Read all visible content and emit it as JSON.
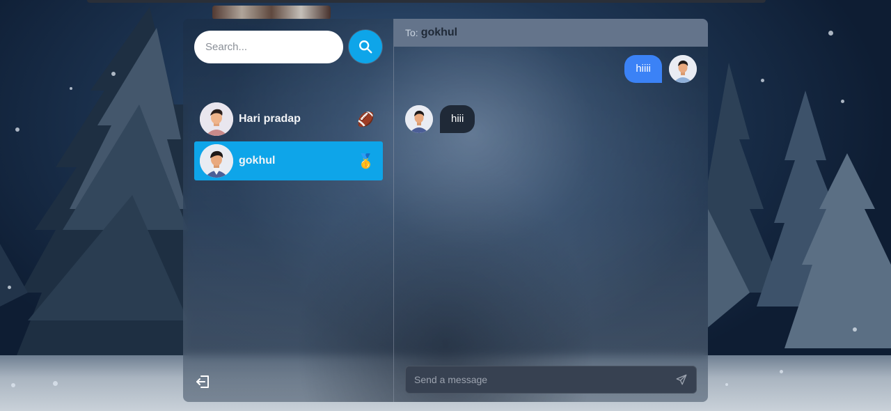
{
  "sidebar": {
    "search": {
      "placeholder": "Search...",
      "value": ""
    },
    "search_button_icon": "search-icon",
    "contacts": [
      {
        "name": "Hari pradap",
        "emoji": "🏈",
        "selected": false
      },
      {
        "name": "gokhul",
        "emoji": "🥇",
        "selected": true
      }
    ],
    "logout_icon": "logout-icon"
  },
  "chat": {
    "header": {
      "to_label": "To:",
      "recipient": "gokhul"
    },
    "messages": [
      {
        "direction": "outgoing",
        "text": "hiiii"
      },
      {
        "direction": "incoming",
        "text": "hiii"
      }
    ],
    "composer": {
      "placeholder": "Send a message",
      "value": "",
      "send_icon": "send-icon"
    }
  },
  "colors": {
    "accent": "#0ea5e9",
    "outgoing_bubble": "#3b82f6",
    "incoming_bubble": "#1f2937",
    "header": "#64748b",
    "composer": "#374151"
  }
}
